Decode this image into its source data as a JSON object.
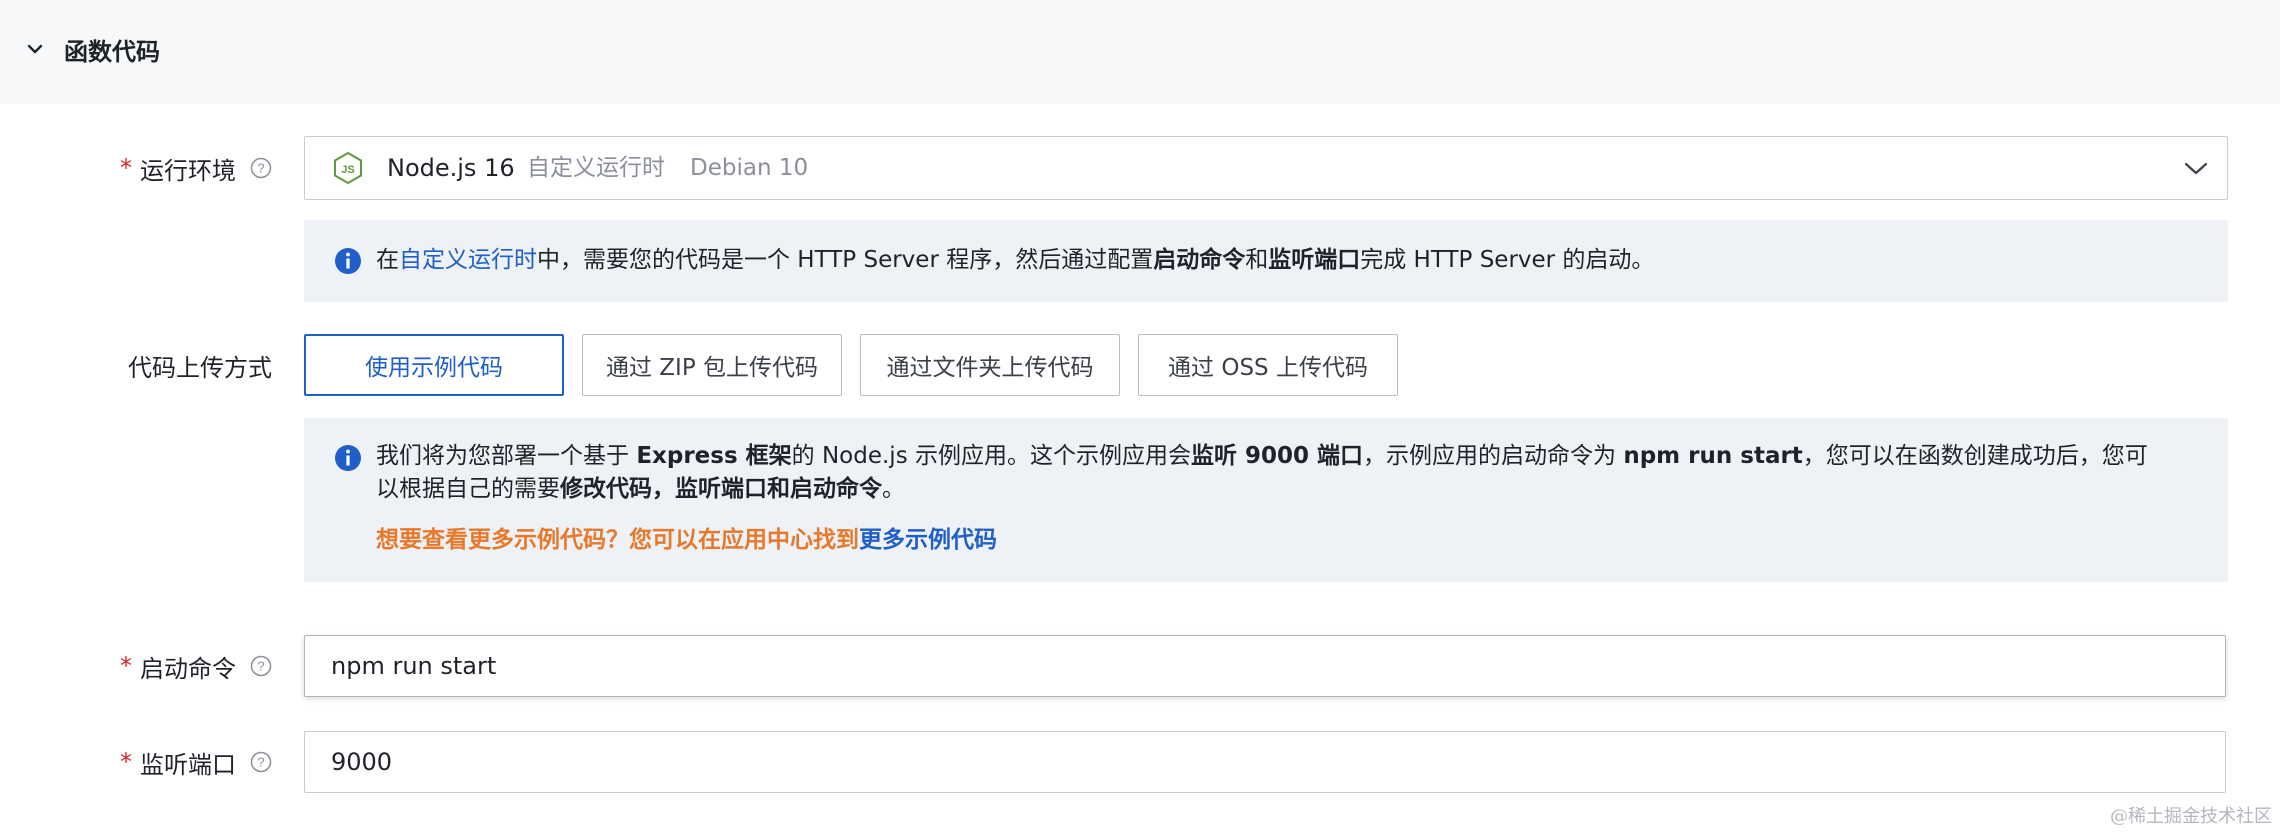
{
  "section": {
    "title": "函数代码"
  },
  "runtime": {
    "label": "运行环境",
    "required_mark": "*",
    "selected_main": "Node.js 16",
    "selected_type": "自定义运行时",
    "selected_os": "Debian 10",
    "icon": "nodejs-icon"
  },
  "runtime_info": {
    "prefix": "在",
    "link": "自定义运行时",
    "mid1": "中，需要您的代码是一个 HTTP Server 程序，然后通过配置",
    "bold1": "启动命令",
    "mid2": "和",
    "bold2": "监听端口",
    "suffix": "完成 HTTP Server 的启动。"
  },
  "upload": {
    "label": "代码上传方式",
    "options": [
      "使用示例代码",
      "通过 ZIP 包上传代码",
      "通过文件夹上传代码",
      "通过 OSS 上传代码"
    ],
    "selected_index": 0
  },
  "sample_info": {
    "t1": "我们将为您部署一个基于 ",
    "b1": "Express 框架",
    "t2": "的 Node.js 示例应用。这个示例应用会",
    "b2": "监听 9000 端口",
    "t3": "，示例应用的启动命令为 ",
    "b3": "npm run start",
    "t4": "，您可以在函数创建成功后，您可",
    "t5": "以根据自己的需要",
    "b4": "修改代码，监听端口和启动命令",
    "t6": "。",
    "more_prompt": "想要查看更多示例代码？您可以在应用中心找到",
    "more_link": "更多示例代码"
  },
  "start_command": {
    "label": "启动命令",
    "required_mark": "*",
    "value": "npm run start"
  },
  "listen_port": {
    "label": "监听端口",
    "required_mark": "*",
    "value": "9000"
  },
  "watermark": "@稀土掘金技术社区",
  "colors": {
    "accent": "#1f5fc7",
    "required": "#d9262e",
    "orange": "#e8782a",
    "info_bg": "#eef1f5"
  }
}
